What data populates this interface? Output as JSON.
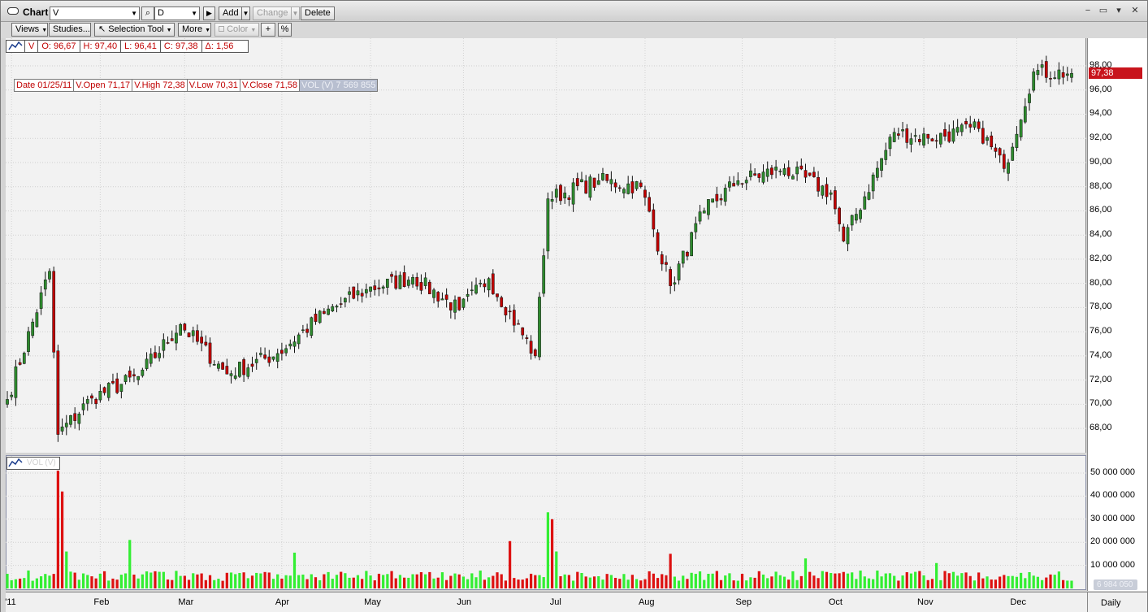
{
  "window": {
    "title": "Chart",
    "symbol_value": "V",
    "period_value": "D",
    "buttons": {
      "add": "Add",
      "change": "Change",
      "delete": "Delete"
    },
    "controls": {
      "minimize": "−",
      "restore": "▭",
      "menu": "▾",
      "close": "✕"
    }
  },
  "toolbar": {
    "views": "Views",
    "studies": "Studies...",
    "selection_tool": "Selection Tool",
    "more": "More",
    "color": "Color",
    "crosshair": "+",
    "percent": "%"
  },
  "legend": {
    "symbol": "V",
    "open": "O: 96,67",
    "high": "H: 97,40",
    "low": "L: 96,41",
    "close": "C: 97,38",
    "delta": "Δ: 1,56"
  },
  "infobox": {
    "date": "Date 01/25/11",
    "open": "V.Open 71,17",
    "high": "V.High 72,38",
    "low": "V.Low 70,31",
    "close": "V.Close 71,58",
    "volume": "VOL (V) 7 569 855"
  },
  "volume_panel": {
    "legend": "VOL (V)",
    "last_value": "6 984 050"
  },
  "last_price_label": "97,38",
  "x_axis_labels": [
    "'11",
    "Feb",
    "Mar",
    "Apr",
    "May",
    "Jun",
    "Jul",
    "Aug",
    "Sep",
    "Oct",
    "Nov",
    "Dec"
  ],
  "x_axis_period": "Daily",
  "colors": {
    "up": "#2e8b2e",
    "down": "#c00000",
    "vol_up": "#33ee33",
    "vol_down": "#dd1111",
    "last_price_bg": "#c8141c"
  },
  "chart_data": {
    "type": "candlestick",
    "title": "",
    "price_axis": {
      "ticks": [
        "68,00",
        "70,00",
        "72,00",
        "74,00",
        "76,00",
        "78,00",
        "80,00",
        "82,00",
        "84,00",
        "86,00",
        "88,00",
        "90,00",
        "92,00",
        "94,00",
        "96,00",
        "98,00"
      ],
      "range": [
        66,
        99
      ]
    },
    "volume_axis": {
      "ticks": [
        "10 000 000",
        "20 000 000",
        "30 000 000",
        "40 000 000",
        "50 000 000"
      ],
      "range": [
        0,
        55000000
      ]
    },
    "close_path": [
      {
        "date": "2010-12-31",
        "close": 70.4
      },
      {
        "date": "2011-01-14",
        "close": 81.0
      },
      {
        "date": "2011-01-18",
        "close": 67.5
      },
      {
        "date": "2011-01-28",
        "close": 70.5
      },
      {
        "date": "2011-02-14",
        "close": 72.3
      },
      {
        "date": "2011-02-28",
        "close": 76.6
      },
      {
        "date": "2011-03-15",
        "close": 72.5
      },
      {
        "date": "2011-03-31",
        "close": 74.2
      },
      {
        "date": "2011-04-15",
        "close": 77.5
      },
      {
        "date": "2011-04-29",
        "close": 79.5
      },
      {
        "date": "2011-05-16",
        "close": 80.5
      },
      {
        "date": "2011-05-31",
        "close": 77.8
      },
      {
        "date": "2011-06-09",
        "close": 80.4
      },
      {
        "date": "2011-06-24",
        "close": 74.0
      },
      {
        "date": "2011-06-29",
        "close": 87.0
      },
      {
        "date": "2011-07-15",
        "close": 88.5
      },
      {
        "date": "2011-07-29",
        "close": 88.0
      },
      {
        "date": "2011-08-09",
        "close": 79.8
      },
      {
        "date": "2011-08-19",
        "close": 86.0
      },
      {
        "date": "2011-08-31",
        "close": 88.5
      },
      {
        "date": "2011-09-15",
        "close": 89.5
      },
      {
        "date": "2011-09-30",
        "close": 87.5
      },
      {
        "date": "2011-10-05",
        "close": 83.5
      },
      {
        "date": "2011-10-21",
        "close": 92.5
      },
      {
        "date": "2011-11-02",
        "close": 92.0
      },
      {
        "date": "2011-11-18",
        "close": 92.8
      },
      {
        "date": "2011-11-28",
        "close": 89.5
      },
      {
        "date": "2011-12-07",
        "close": 97.5
      },
      {
        "date": "2011-12-20",
        "close": 97.38
      }
    ],
    "volume_spikes": [
      {
        "date": "2011-01-18",
        "volume": 51000000,
        "dir": "down"
      },
      {
        "date": "2011-01-19",
        "volume": 42000000,
        "dir": "down"
      },
      {
        "date": "2011-01-20",
        "volume": 16000000,
        "dir": "up"
      },
      {
        "date": "2011-02-10",
        "volume": 21000000,
        "dir": "up"
      },
      {
        "date": "2011-04-06",
        "volume": 15500000,
        "dir": "up"
      },
      {
        "date": "2011-06-16",
        "volume": 20500000,
        "dir": "down"
      },
      {
        "date": "2011-06-29",
        "volume": 33000000,
        "dir": "up"
      },
      {
        "date": "2011-06-30",
        "volume": 30000000,
        "dir": "down"
      },
      {
        "date": "2011-07-01",
        "volume": 16000000,
        "dir": "up"
      },
      {
        "date": "2011-08-09",
        "volume": 15000000,
        "dir": "down"
      },
      {
        "date": "2011-09-22",
        "volume": 13000000,
        "dir": "up"
      },
      {
        "date": "2011-11-04",
        "volume": 11000000,
        "dir": "up"
      }
    ],
    "typical_volume": 6000000
  }
}
